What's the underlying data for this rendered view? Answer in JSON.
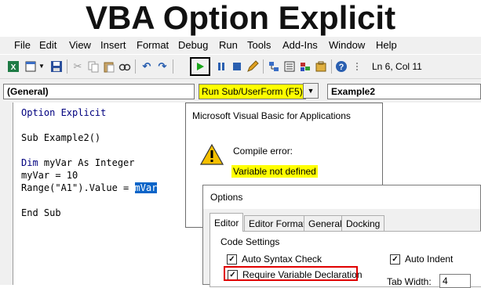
{
  "banner": {
    "title": "VBA Option Explicit"
  },
  "menu": [
    "File",
    "Edit",
    "View",
    "Insert",
    "Format",
    "Debug",
    "Run",
    "Tools",
    "Add-Ins",
    "Window",
    "Help"
  ],
  "toolbar": {
    "status": "Ln 6, Col 11"
  },
  "objects_combo": {
    "value": "(General)"
  },
  "tooltip": {
    "text": "Run Sub/UserForm (F5)"
  },
  "procedure_combo": {
    "value": "Example2"
  },
  "code": {
    "line1": "Option Explicit",
    "line2": "Sub Example2()",
    "line3_kw": "Dim",
    "line3_rest": " myVar As Integer",
    "line4": "myVar = 10",
    "line5_prefix": "Range(\"A1\").Value = ",
    "line5_selected": "mVar",
    "line6": "End Sub"
  },
  "msgbox": {
    "title": "Microsoft Visual Basic for Applications",
    "heading": "Compile error:",
    "text": "Variable not defined"
  },
  "options": {
    "title": "Options",
    "tabs": [
      "Editor",
      "Editor Format",
      "General",
      "Docking"
    ],
    "group": "Code Settings",
    "auto_syntax": "Auto Syntax Check",
    "require_var": "Require Variable Declaration",
    "auto_indent": "Auto Indent",
    "tab_width_label": "Tab Width:",
    "tab_width_value": "4"
  },
  "colors": {
    "highlight": "#ffff00",
    "selection": "#0a64c8",
    "callout": "#e00000"
  }
}
